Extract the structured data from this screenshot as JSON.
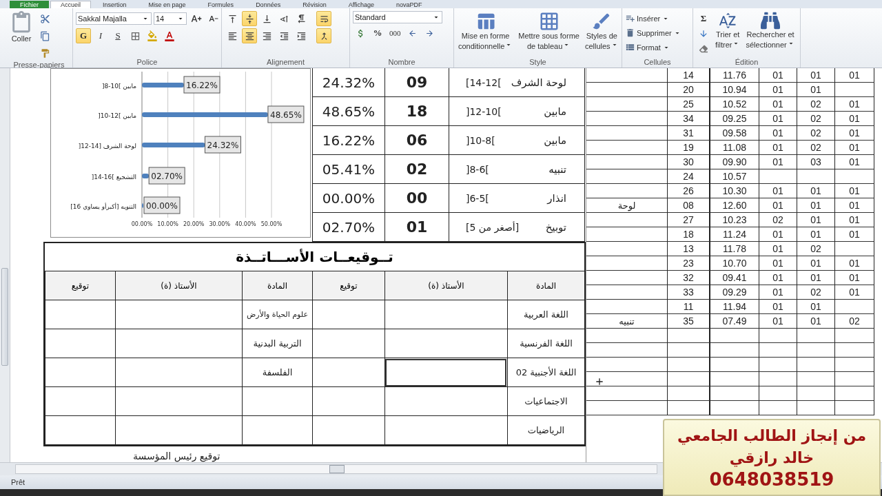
{
  "ribbon_tabs": [
    {
      "label": "Fichier",
      "selected": false
    },
    {
      "label": "Accueil",
      "selected": true
    },
    {
      "label": "Insertion",
      "selected": false
    },
    {
      "label": "Mise en page",
      "selected": false
    },
    {
      "label": "Formules",
      "selected": false
    },
    {
      "label": "Données",
      "selected": false
    },
    {
      "label": "Révision",
      "selected": false
    },
    {
      "label": "Affichage",
      "selected": false
    },
    {
      "label": "novaPDF",
      "selected": false
    }
  ],
  "clipboard": {
    "paste_label": "Coller",
    "group_label": "Presse-papiers"
  },
  "font": {
    "name": "Sakkal Majalla",
    "size": "14",
    "group_label": "Police",
    "styles": [
      {
        "kind": "bold",
        "label": "G",
        "on": true
      },
      {
        "kind": "italic",
        "label": "I",
        "on": false
      },
      {
        "kind": "underline",
        "label": "S",
        "on": false
      }
    ]
  },
  "alignment": {
    "group_label": "Alignement",
    "buttons": [
      {
        "kind": "top",
        "on": false
      },
      {
        "kind": "middle",
        "on": true
      },
      {
        "kind": "bottom",
        "on": false
      },
      {
        "kind": "orientation",
        "on": false
      },
      {
        "kind": "rtl",
        "on": false
      },
      {
        "kind": "wrap",
        "on": true
      },
      {
        "kind": "left",
        "on": false
      },
      {
        "kind": "center",
        "on": true
      },
      {
        "kind": "right",
        "on": false
      },
      {
        "kind": "outdent",
        "on": false
      },
      {
        "kind": "indent",
        "on": false
      },
      {
        "kind": "merge",
        "on": true
      }
    ]
  },
  "number": {
    "format": "Standard",
    "percent": "%",
    "thousands": "000",
    "group_label": "Nombre"
  },
  "styles": {
    "group_label": "Style",
    "buttons": [
      {
        "kind": "conditional",
        "lines": [
          "Mise en forme",
          "conditionnelle"
        ]
      },
      {
        "kind": "table",
        "lines": [
          "Mettre sous forme",
          "de tableau"
        ]
      },
      {
        "kind": "cell",
        "lines": [
          "Styles de",
          "cellules"
        ]
      }
    ]
  },
  "cells": {
    "group_label": "Cellules",
    "buttons": [
      {
        "kind": "insert",
        "label": "Insérer"
      },
      {
        "kind": "delete",
        "label": "Supprimer"
      },
      {
        "kind": "format",
        "label": "Format"
      }
    ]
  },
  "editing": {
    "group_label": "Édition",
    "sum": "Σ",
    "buttons": [
      {
        "kind": "sort",
        "lines": [
          "Trier et",
          "filtrer"
        ]
      },
      {
        "kind": "find",
        "lines": [
          "Rechercher et",
          "sélectionner"
        ]
      }
    ]
  },
  "chart": {
    "chart_data": {
      "type": "bar",
      "orientation": "horizontal",
      "categories": [
        "مابين ]10-8[",
        "مابين ]12-10[",
        "لوحة الشرف [14-12[",
        "التشجيع ]16-14[",
        "التنويه [أكبرأو يساوي 16]"
      ],
      "series": [
        {
          "color": "#4f81bd",
          "values": [
            16.22,
            48.65,
            24.32,
            2.7,
            0
          ]
        }
      ],
      "grid": true,
      "xlim": [
        0,
        50
      ],
      "xticks": [
        {
          "value": 0,
          "label": "00.00%"
        },
        {
          "value": 10,
          "label": "10.00%"
        },
        {
          "value": 20,
          "label": "20.00%"
        },
        {
          "value": 30,
          "label": "30.00%"
        },
        {
          "value": 40,
          "label": "40.00%"
        },
        {
          "value": 50,
          "label": "50.00%"
        }
      ],
      "value_labels": [
        "16.22%",
        "48.65%",
        "24.32%",
        "02.70%",
        "00.00%"
      ]
    }
  },
  "stats": {
    "rows": [
      {
        "name": "لوحة الشرف",
        "range": "[14-12[",
        "count": "09",
        "percent": "24.32%"
      },
      {
        "name": "مابين",
        "range": "]12-10[",
        "count": "18",
        "percent": "48.65%"
      },
      {
        "name": "مابين",
        "range": "]10-8[",
        "count": "06",
        "percent": "16.22%"
      },
      {
        "name": "تنبيه",
        "range": "]8-6[",
        "count": "02",
        "percent": "05.41%"
      },
      {
        "name": "انذار",
        "range": "]6-5[",
        "count": "00",
        "percent": "00.00%"
      },
      {
        "name": "توبيخ",
        "range": "[أصغر من 5]",
        "count": "01",
        "percent": "02.70%"
      }
    ]
  },
  "signatures": {
    "title": "تــوقيعــات الأســـاتــذة",
    "headers": [
      "المادة",
      "الأستاذ (ة)",
      "توقيع",
      "المادة",
      "الأستاذ (ة)",
      "توقيع"
    ],
    "rows": [
      {
        "subject_1": "اللغة العربية",
        "subject_2": "علوم الحياة والأرض",
        "teacher_selected": false
      },
      {
        "subject_1": "اللغة الفرنسية",
        "subject_2": "التربية البدنية",
        "teacher_selected": false
      },
      {
        "subject_1": "اللغة الأجنبية 02",
        "subject_2": "الفلسفة",
        "teacher_selected": true
      },
      {
        "subject_1": "الاجتماعيات",
        "teacher_selected": false
      },
      {
        "subject_1": "الرياضيات",
        "teacher_selected": false
      }
    ],
    "footer": "توقيع رئيس المؤسسة"
  },
  "grades": {
    "rows": [
      {
        "column_2": "14",
        "column_3": "11.76",
        "column_4": "01",
        "column_5": "01",
        "column_6": "01"
      },
      {
        "column_2": "20",
        "column_3": "10.94",
        "column_4": "01",
        "column_5": "01"
      },
      {
        "column_2": "25",
        "column_3": "10.52",
        "column_4": "01",
        "column_5": "02",
        "column_6": "01"
      },
      {
        "column_2": "34",
        "column_3": "09.25",
        "column_4": "01",
        "column_5": "02",
        "column_6": "01"
      },
      {
        "column_2": "31",
        "column_3": "09.58",
        "column_4": "01",
        "column_5": "02",
        "column_6": "01"
      },
      {
        "column_2": "19",
        "column_3": "11.08",
        "column_4": "01",
        "column_5": "02",
        "column_6": "01"
      },
      {
        "column_2": "30",
        "column_3": "09.90",
        "column_4": "01",
        "column_5": "03",
        "column_6": "01"
      },
      {
        "column_2": "24",
        "column_3": "10.57"
      },
      {
        "column_2": "26",
        "column_3": "10.30",
        "column_4": "01",
        "column_5": "01",
        "column_6": "01"
      },
      {
        "column_1": "لوحة",
        "column_2": "08",
        "column_3": "12.60",
        "column_4": "01",
        "column_5": "01",
        "column_6": "01"
      },
      {
        "column_2": "27",
        "column_3": "10.23",
        "column_4": "02",
        "column_5": "01",
        "column_6": "01"
      },
      {
        "column_2": "18",
        "column_3": "11.24",
        "column_4": "01",
        "column_5": "01",
        "column_6": "01"
      },
      {
        "column_2": "13",
        "column_3": "11.78",
        "column_4": "01",
        "column_5": "02"
      },
      {
        "column_2": "23",
        "column_3": "10.70",
        "column_4": "01",
        "column_5": "01",
        "column_6": "01"
      },
      {
        "column_2": "32",
        "column_3": "09.41",
        "column_4": "01",
        "column_5": "01",
        "column_6": "01"
      },
      {
        "column_2": "33",
        "column_3": "09.29",
        "column_4": "01",
        "column_5": "02",
        "column_6": "01"
      },
      {
        "column_2": "11",
        "column_3": "11.94",
        "column_4": "01",
        "column_5": "01"
      },
      {
        "column_1": "تنبيه",
        "column_2": "35",
        "column_3": "07.49",
        "column_4": "01",
        "column_5": "01",
        "column_6": "02"
      }
    ]
  },
  "status_bar": {
    "text": "Prêt"
  },
  "credit": {
    "lines": [
      "من إنجاز الطالب الجامعي",
      "خالد رازقي",
      "0648038519"
    ]
  }
}
